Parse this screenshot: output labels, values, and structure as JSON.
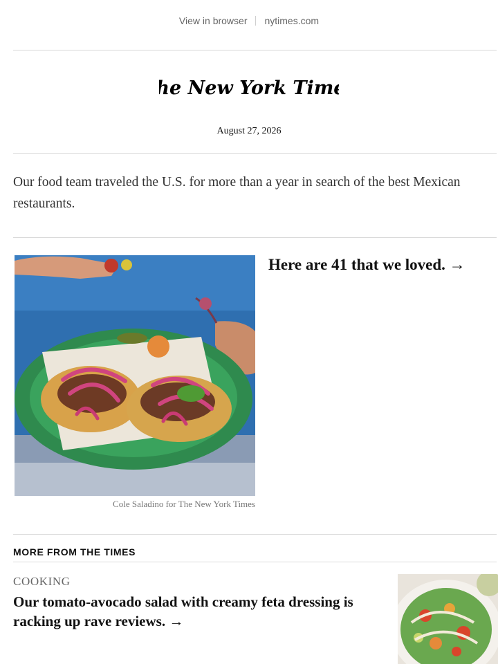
{
  "header": {
    "view_in_browser": "View in browser",
    "site_link": "nytimes.com"
  },
  "masthead": {
    "logo_text": "The New York Times",
    "date": "August 27, 2026"
  },
  "intro": {
    "text": "Our food team traveled the U.S. for more than a year in search of the best Mexican restaurants."
  },
  "hero": {
    "image_icon": "tacos-photo",
    "caption": "Cole Saladino for The New York Times",
    "headline_link": "Here are 41 that we loved. →"
  },
  "more": {
    "section_label": "MORE FROM THE TIMES",
    "stories": [
      {
        "kicker": "COOKING",
        "headline": "Our tomato-avocado salad with creamy feta dressing is racking up rave reviews. →",
        "image_icon": "salad-photo"
      }
    ]
  }
}
